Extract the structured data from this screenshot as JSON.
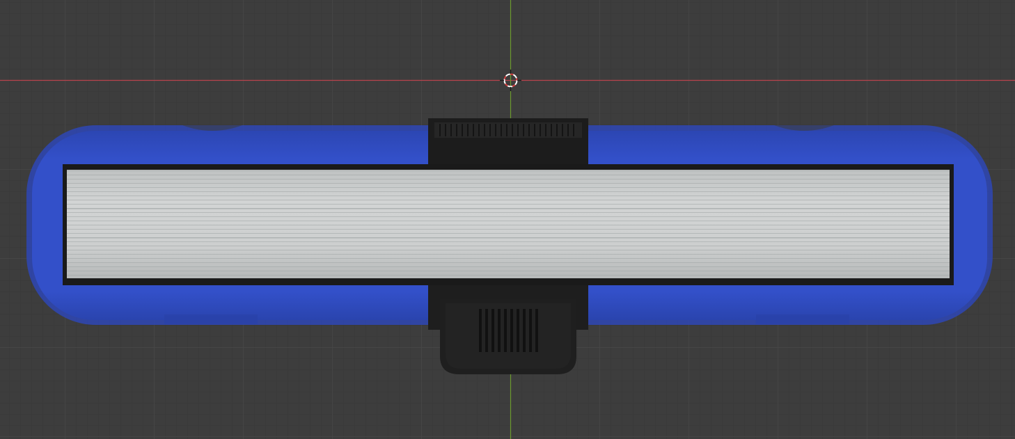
{
  "viewport": {
    "background_color": "#3d3d3d",
    "grid_color": "#464646",
    "x_axis_color": "#b8434d",
    "y_axis_color": "#6b9a2e"
  },
  "scene": {
    "objects": [
      {
        "name": "blue-body",
        "color": "#2f4ec4"
      },
      {
        "name": "light-panel",
        "color": "#c9cbcb"
      },
      {
        "name": "black-clip",
        "color": "#1d1d1d"
      }
    ]
  },
  "icons": {
    "cursor": "3d-cursor-icon"
  }
}
